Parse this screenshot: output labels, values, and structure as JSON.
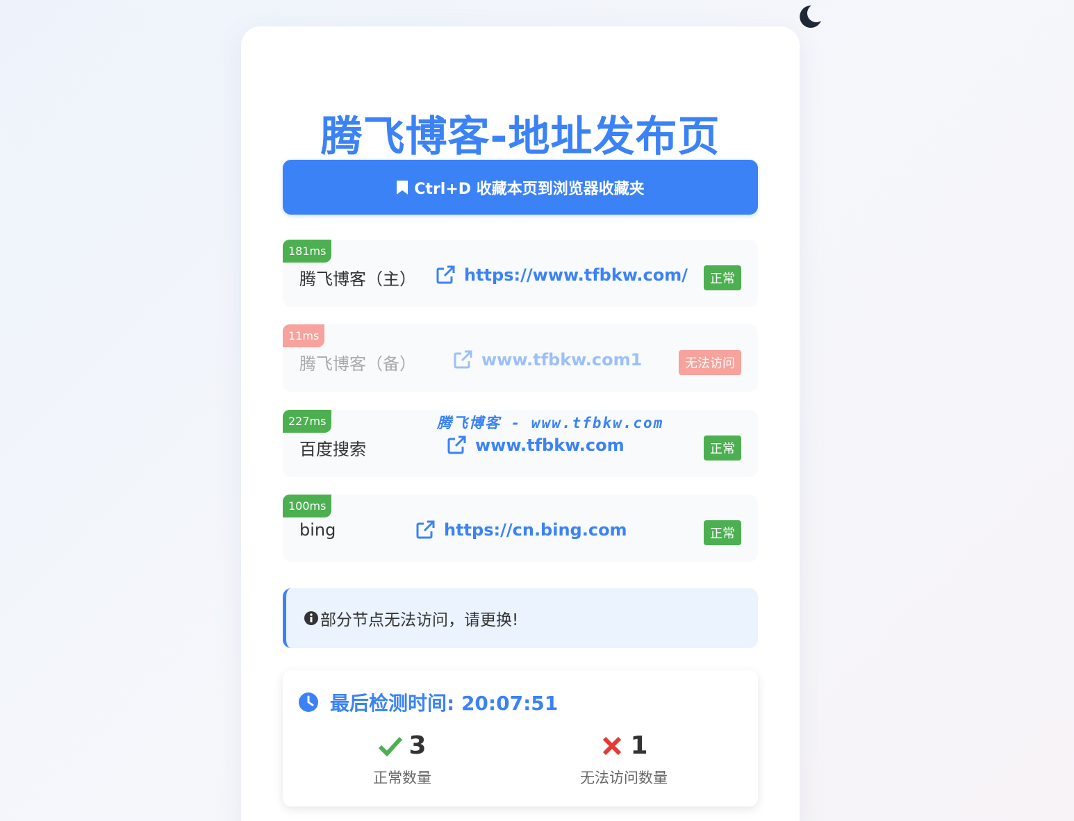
{
  "page": {
    "title": "腾飞博客-地址发布页",
    "bookmark_label": "Ctrl+D 收藏本页到浏览器收藏夹"
  },
  "sites": [
    {
      "latency": "181ms",
      "name": "腾飞博客（主）",
      "url": "https://www.tfbkw.com/",
      "status": "正常",
      "ok": true
    },
    {
      "latency": "11ms",
      "name": "腾飞博客（备）",
      "url": "www.tfbkw.com1",
      "status": "无法访问",
      "ok": false
    },
    {
      "latency": "227ms",
      "name": "百度搜索",
      "url": "www.tfbkw.com",
      "status": "正常",
      "ok": true,
      "watermark": "腾飞博客 - www.tfbkw.com"
    },
    {
      "latency": "100ms",
      "name": "bing",
      "url": "https://cn.bing.com",
      "status": "正常",
      "ok": true
    }
  ],
  "notice": {
    "text": "部分节点无法访问，请更换!"
  },
  "stats": {
    "last_check": "最后检测时间: 20:07:51",
    "ok_count": "3",
    "ok_label": "正常数量",
    "fail_count": "1",
    "fail_label": "无法访问数量"
  },
  "colors": {
    "accent": "#3b82f6",
    "ok": "#4caf50",
    "bad": "#f7a29c",
    "fail_icon": "#e53935"
  },
  "icons": {
    "theme": "moon-icon",
    "bookmark": "bookmark-icon",
    "link": "external-link-icon",
    "info": "info-icon",
    "clock": "clock-icon",
    "ok": "check-icon",
    "fail": "x-icon"
  }
}
